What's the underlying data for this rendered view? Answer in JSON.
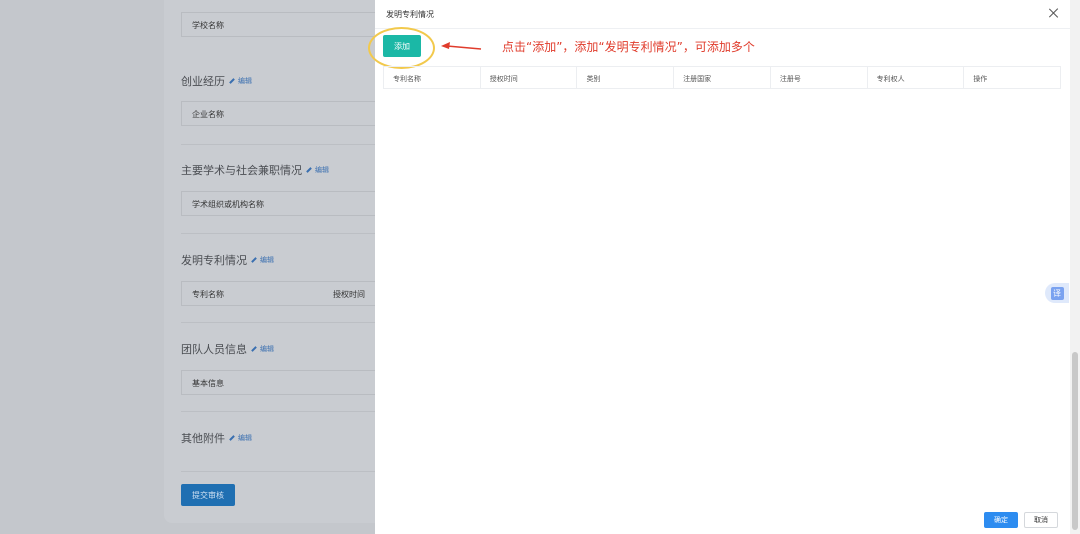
{
  "background": {
    "school_name_label": "学校名称",
    "sections": [
      {
        "title": "创业经历",
        "edit": "编辑",
        "field": "企业名称"
      },
      {
        "title": "主要学术与社会兼职情况",
        "edit": "编辑",
        "field": "学术组织或机构名称"
      },
      {
        "title": "发明专利情况",
        "edit": "编辑",
        "field": "专利名称",
        "field2": "授权时间"
      },
      {
        "title": "团队人员信息",
        "edit": "编辑",
        "field": "基本信息"
      },
      {
        "title": "其他附件",
        "edit": "编辑"
      }
    ],
    "submit_label": "提交审核"
  },
  "drawer": {
    "title": "发明专利情况",
    "add_label": "添加",
    "annotation": "点击“添加”，添加“发明专利情况”，可添加多个",
    "columns": [
      "专利名称",
      "授权时间",
      "类别",
      "注册国家",
      "注册号",
      "专利权人",
      "操作"
    ],
    "confirm_label": "确定",
    "cancel_label": "取消"
  },
  "floating": {
    "translate_label": "译"
  },
  "colors": {
    "accent": "#1bb8a6",
    "primary": "#2d8cf0",
    "annotation": "#e03c2c",
    "highlight": "#f2c94c"
  }
}
